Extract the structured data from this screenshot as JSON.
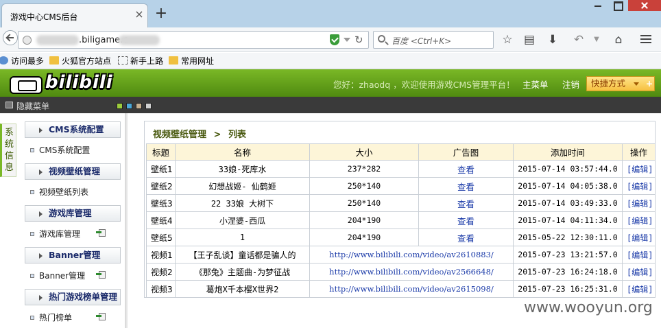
{
  "browser": {
    "tab_title": "游戏中心CMS后台",
    "url_visible": ".biligame.c",
    "search_placeholder": "百度 <Ctrl+K>",
    "bookmarks": [
      "访问最多",
      "火狐官方站点",
      "新手上路",
      "常用网址"
    ]
  },
  "header": {
    "logo_text": "bilibili",
    "greeting": "您好：zhaodq ，欢迎使用游戏CMS管理平台！",
    "main_menu": "主菜单",
    "logout": "注销",
    "shortcut": "快捷方式"
  },
  "toolbar": {
    "hide_menu": "隐藏菜单",
    "swatches": [
      "#9ccc3c",
      "#4aa7d8",
      "#c8b090",
      "#d0d0d0"
    ]
  },
  "left_tab": "系统信息",
  "sidebar": {
    "sections": [
      {
        "title": "CMS系统配置",
        "items": [
          {
            "label": "CMS系统配置",
            "icon": false
          }
        ]
      },
      {
        "title": "视频壁纸管理",
        "items": [
          {
            "label": "视频壁纸列表",
            "icon": false
          }
        ]
      },
      {
        "title": "游戏库管理",
        "items": [
          {
            "label": "游戏库管理",
            "icon": true
          }
        ]
      },
      {
        "title": "Banner管理",
        "items": [
          {
            "label": "Banner管理",
            "icon": true
          }
        ]
      },
      {
        "title": "热门游戏榜单管理",
        "items": [
          {
            "label": "热门榜单",
            "icon": true
          }
        ]
      }
    ]
  },
  "content": {
    "breadcrumb_parent": "视频壁纸管理",
    "breadcrumb_sep": ">",
    "breadcrumb_current": "列表",
    "columns": [
      "标题",
      "名称",
      "大小",
      "广告图",
      "添加时间",
      "操作"
    ],
    "rows": [
      {
        "title": "壁纸1",
        "name": "33娘-死库水",
        "size": "237*282",
        "ad": "查看",
        "time": "2015-07-14 03:57:44.0",
        "op": "[编辑]"
      },
      {
        "title": "壁纸2",
        "name": "幻想战姬- 仙鹤姬",
        "size": "250*140",
        "ad": "查看",
        "time": "2015-07-14 04:05:38.0",
        "op": "[编辑]"
      },
      {
        "title": "壁纸3",
        "name": "22 33娘 大树下",
        "size": "250*140",
        "ad": "查看",
        "time": "2015-07-14 03:49:33.0",
        "op": "[编辑]"
      },
      {
        "title": "壁纸4",
        "name": "小涅婆-西瓜",
        "size": "204*190",
        "ad": "查看",
        "time": "2015-07-14 04:11:34.0",
        "op": "[编辑]"
      },
      {
        "title": "壁纸5",
        "name": "1",
        "size": "204*190",
        "ad": "查看",
        "time": "2015-05-22 12:30:11.0",
        "op": "[编辑]"
      },
      {
        "title": "视频1",
        "name": "【王子乱谈】童话都是骗人的",
        "link": "http://www.bilibili.com/video/av2610883/",
        "time": "2015-07-23 13:21:57.0",
        "op": "[编辑]"
      },
      {
        "title": "视频2",
        "name": "《那兔》主题曲-为梦征战",
        "link": "http://www.bilibili.com/video/av2566648/",
        "time": "2015-07-23 16:24:18.0",
        "op": "[编辑]"
      },
      {
        "title": "视频3",
        "name": "葛炮X千本樱X世界2",
        "link": "http://www.bilibili.com/video/av2615098/",
        "time": "2015-07-23 16:25:31.0",
        "op": "[编辑]"
      }
    ]
  },
  "watermark": "www.wooyun.org"
}
